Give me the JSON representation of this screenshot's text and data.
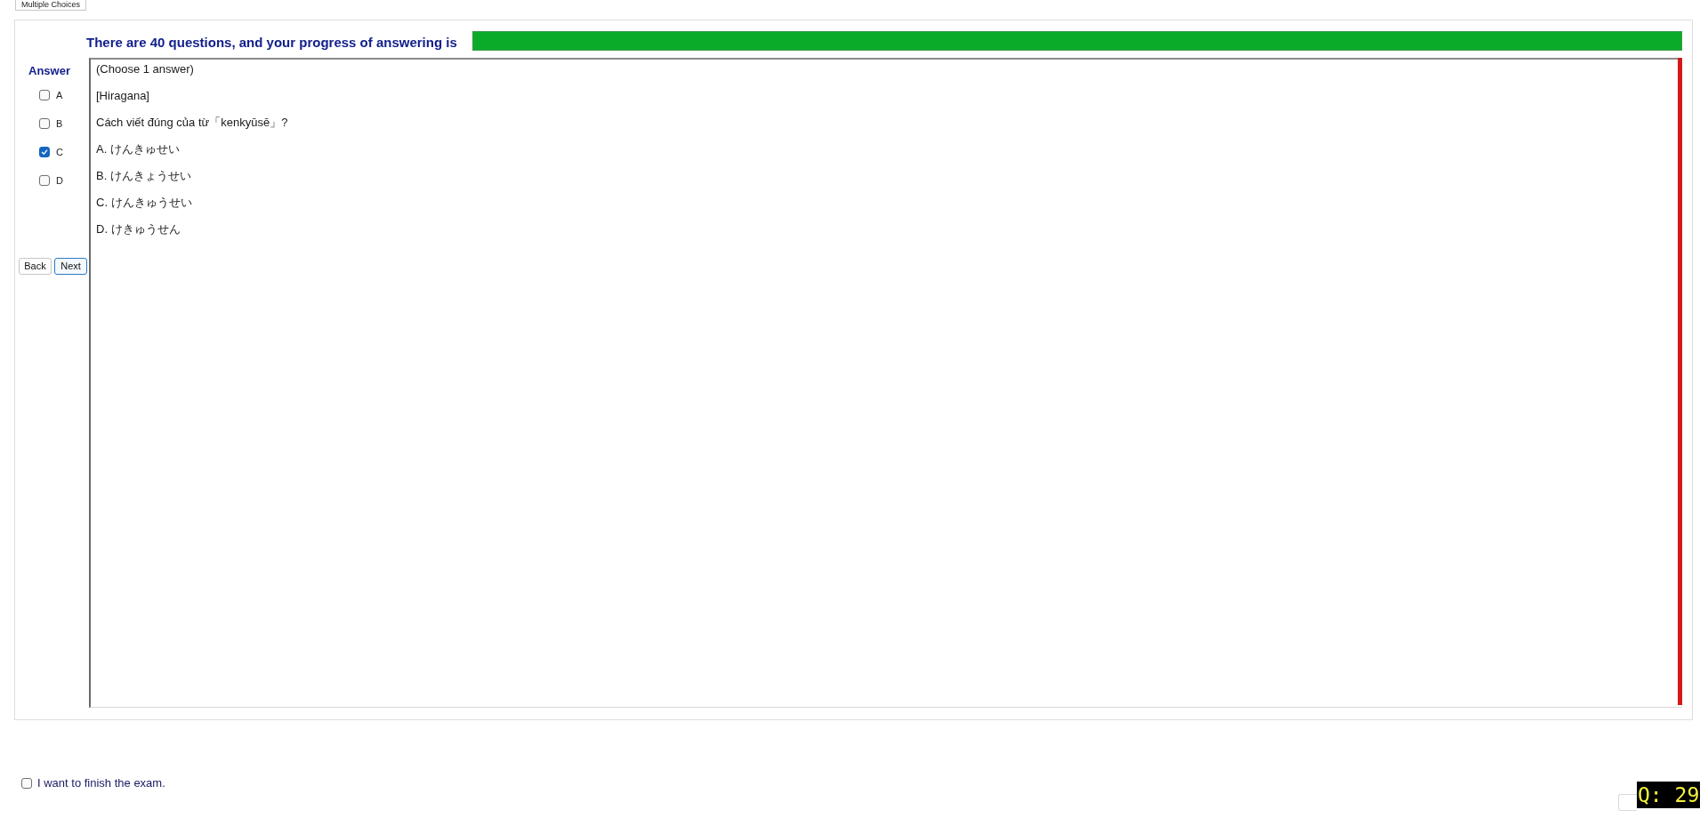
{
  "tabs": [
    {
      "label": "Multiple Choices",
      "selected": true
    }
  ],
  "progress": {
    "text": "There are 40 questions, and your progress of answering is",
    "level": 1
  },
  "answer_panel": {
    "title": "Answer",
    "options": [
      {
        "label": "A",
        "checked": false
      },
      {
        "label": "B",
        "checked": false
      },
      {
        "label": "C",
        "checked": true
      },
      {
        "label": "D",
        "checked": false
      }
    ],
    "buttons": [
      {
        "label": "Back",
        "focused": false
      },
      {
        "label": "Next",
        "focused": true
      }
    ]
  },
  "question": {
    "lines": [
      "(Choose 1 answer)",
      "[Hiragana]",
      "Cách viết đúng của từ「kenkyūsē」?",
      "A. けんきゅせい",
      "B. けんきょうせい",
      "C. けんきゅうせい",
      "D. けきゅうせん"
    ]
  },
  "finish": {
    "label": "I want to finish the exam.",
    "checked": false
  },
  "question_badge": "Q: 29"
}
